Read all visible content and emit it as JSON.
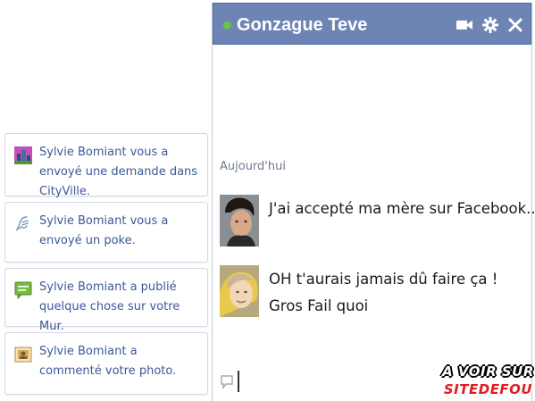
{
  "notifications": [
    {
      "text": "Sylvie Bomiant vous a envoyé une demande dans CityVille.",
      "icon": "cityville-icon"
    },
    {
      "text": "Sylvie Bomiant vous a envoyé un poke.",
      "icon": "poke-icon"
    },
    {
      "text": "Sylvie Bomiant a publié quelque chose sur votre Mur.",
      "icon": "wall-post-icon"
    },
    {
      "text": "Sylvie Bomiant a commenté votre photo.",
      "icon": "photo-comment-icon"
    }
  ],
  "chat": {
    "name": "Gonzague Teve",
    "status": "online",
    "date_label": "Aujourd'hui",
    "messages": [
      {
        "lines": [
          "J'ai accepté ma mère sur Facebook..."
        ]
      },
      {
        "lines": [
          "OH t'aurais jamais dû faire ça !",
          "Gros Fail quoi"
        ]
      }
    ]
  },
  "watermark": {
    "line1": "A VOIR SUR",
    "line2": "SITEDEFOU"
  },
  "colors": {
    "header": "#6d84b4",
    "link": "#3b5998",
    "presence": "#67c548"
  }
}
